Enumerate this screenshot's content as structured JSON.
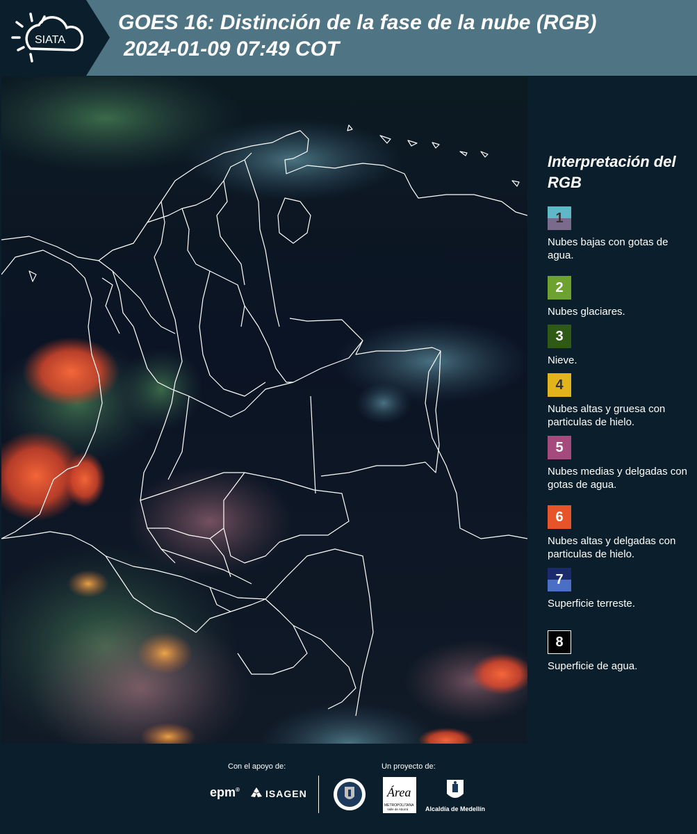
{
  "header": {
    "logo_text": "SIATA",
    "title_line1": "GOES 16: Distinción de la fase de la nube (RGB)",
    "title_line2": "2024-01-09 07:49 COT",
    "background_color": "#4f7484"
  },
  "map": {
    "description_icon": "satellite-rgb-map",
    "border_color": "#ffffff"
  },
  "legend": {
    "title": "Interpretación del RGB",
    "items": [
      {
        "number": "1",
        "label": "Nubes bajas con gotas de agua.",
        "color_top": "#5db8c8",
        "color_bottom": "#7a6b8c",
        "num_color": "#333333"
      },
      {
        "number": "2",
        "label": "Nubes glaciares.",
        "color_top": "#6da22f",
        "color_bottom": "#6da22f",
        "num_color": "#ffffff"
      },
      {
        "number": "3",
        "label": "Nieve.",
        "color_top": "#2e5a16",
        "color_bottom": "#2e5a16",
        "num_color": "#ffffff"
      },
      {
        "number": "4",
        "label": "Nubes altas y gruesa con particulas de hielo.",
        "color_top": "#e2b41c",
        "color_bottom": "#e2b41c",
        "num_color": "#333333"
      },
      {
        "number": "5",
        "label": "Nubes medias y delgadas con gotas de agua.",
        "color_top": "#a54a7d",
        "color_bottom": "#a54a7d",
        "num_color": "#ffffff"
      },
      {
        "number": "6",
        "label": "Nubes altas y delgadas con particulas de hielo.",
        "color_top": "#e7542a",
        "color_bottom": "#e7542a",
        "num_color": "#ffffff"
      },
      {
        "number": "7",
        "label": "Superficie terreste.",
        "color_top": "#1a2a6c",
        "color_bottom": "#4b6fc4",
        "num_color": "#ffffff"
      },
      {
        "number": "8",
        "label": "Superficie de agua.",
        "color_top": "#000000",
        "color_bottom": "#000000",
        "num_color": "#ffffff"
      }
    ]
  },
  "footer": {
    "support_label": "Con el apoyo de:",
    "project_label": "Un proyecto de:",
    "epm_text": "epm",
    "isagen_text": "ISAGEN",
    "area_text": "Área",
    "area_sub1": "METROPOLITANA",
    "area_sub2": "Valle de Aburrá",
    "alcaldia_text": "Alcaldía de Medellín"
  }
}
